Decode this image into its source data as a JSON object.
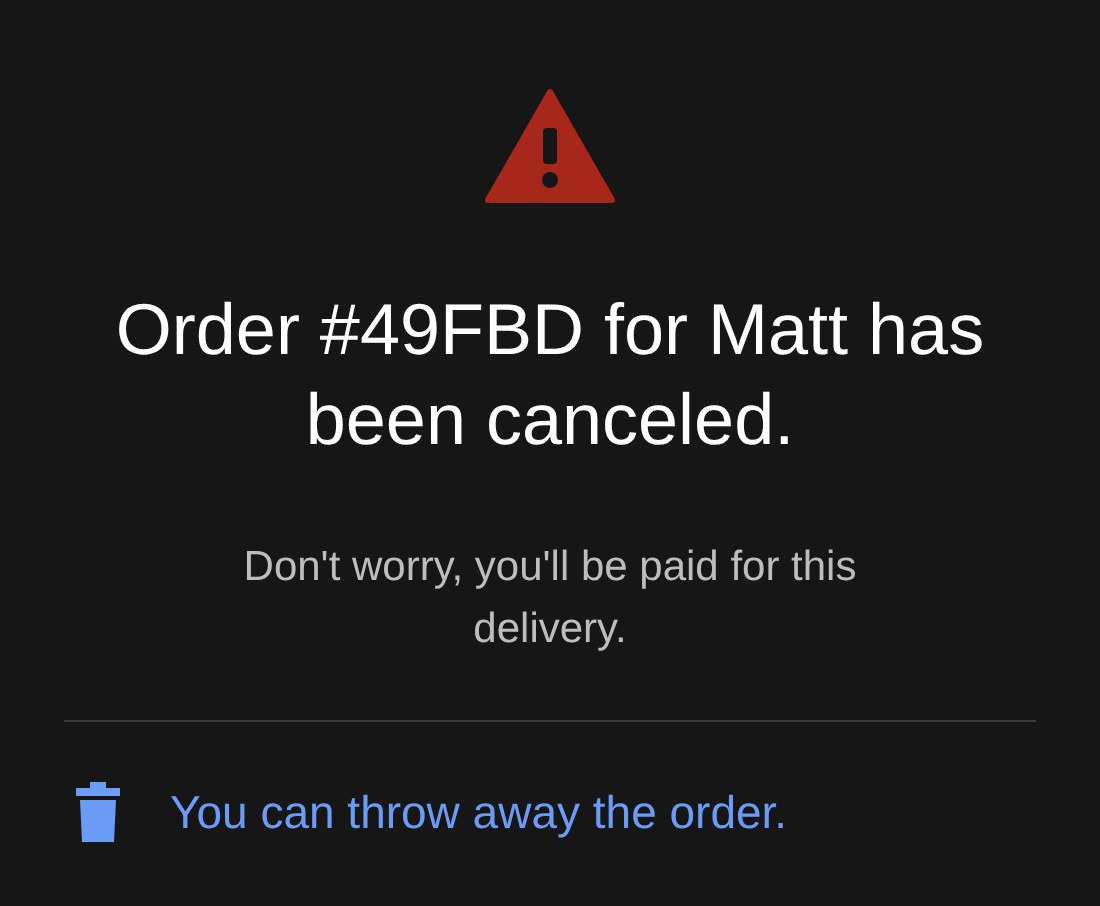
{
  "title": "Order #49FBD for Matt has been canceled.",
  "message": "Don't worry, you'll be paid for this delivery.",
  "action": {
    "label": "You can throw away the order."
  }
}
